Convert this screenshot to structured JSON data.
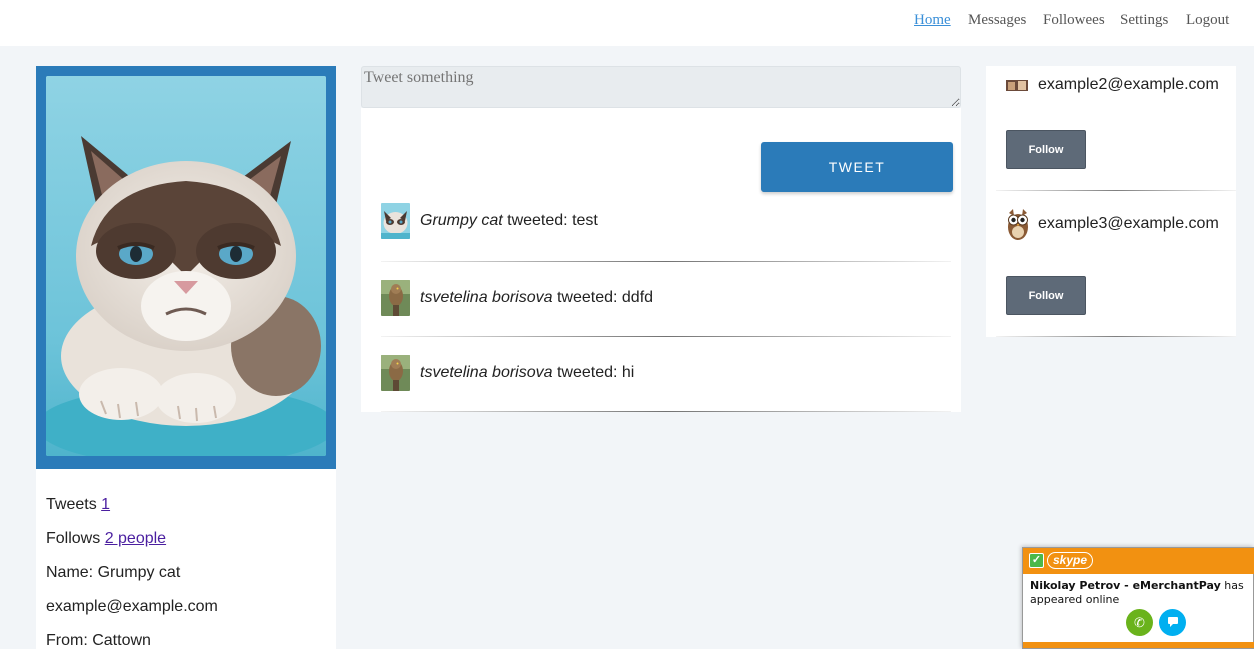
{
  "nav": {
    "items": [
      {
        "label": "Home",
        "active": true
      },
      {
        "label": "Messages"
      },
      {
        "label": "Followees"
      },
      {
        "label": "Settings"
      },
      {
        "label": "Logout"
      }
    ]
  },
  "profile": {
    "tweets_label": "Tweets",
    "tweets_count": "1",
    "follows_label": "Follows",
    "follows_link": "2 people",
    "name_line": "Name: Grumpy cat",
    "email": "example@example.com",
    "from_line": "From: Cattown"
  },
  "composer": {
    "placeholder": "Tweet something",
    "button_label": "TWEET"
  },
  "tweets": [
    {
      "author": "Grumpy cat",
      "verb": " tweeted: ",
      "content": "test",
      "avatar": "grumpy-cat-avatar"
    },
    {
      "author": "tsvetelina borisova",
      "verb": " tweeted: ",
      "content": "ddfd",
      "avatar": "owl-bird-avatar"
    },
    {
      "author": "tsvetelina borisova",
      "verb": " tweeted: ",
      "content": "hi",
      "avatar": "owl-bird-avatar"
    }
  ],
  "suggestions": [
    {
      "email": "example2@example.com",
      "button": "Follow"
    },
    {
      "email": "example3@example.com",
      "button": "Follow"
    }
  ],
  "skype": {
    "logo": "skype",
    "contact": "Nikolay Petrov - eMerchantPay",
    "status": " has appeared online"
  },
  "colors": {
    "accent": "#2b7bb9",
    "link_active": "#3a8fd8",
    "follow_button": "#5e6a78",
    "skype_orange": "#f29111"
  }
}
